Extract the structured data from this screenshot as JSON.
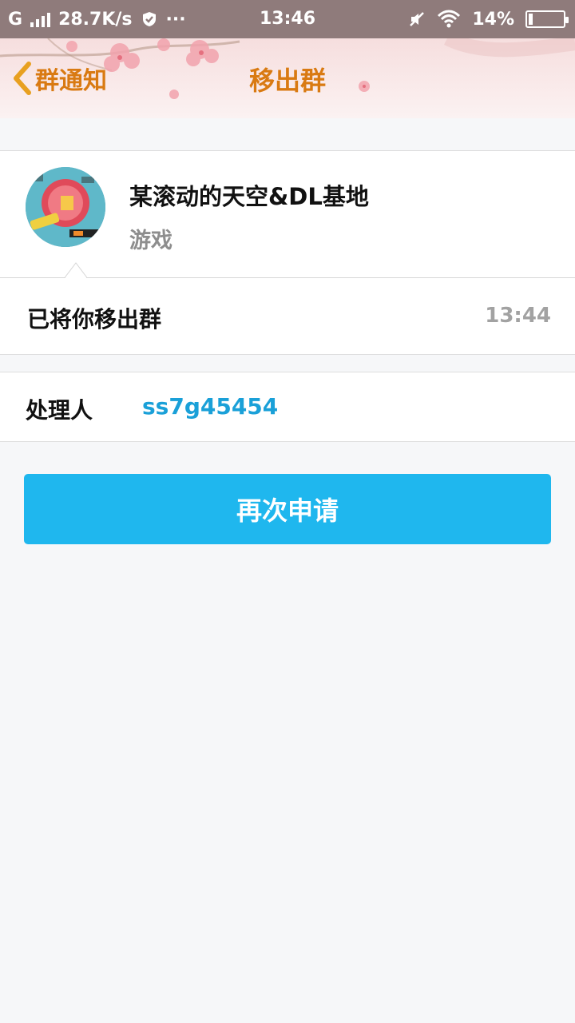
{
  "status_bar": {
    "network": "G",
    "speed": "28.7K/s",
    "more": "···",
    "time": "13:46",
    "battery": "14%"
  },
  "header": {
    "back_label": "群通知",
    "title": "移出群",
    "text_color": "#d97a12"
  },
  "group": {
    "name": "某滚动的天空&DL基地",
    "category": "游戏"
  },
  "notice": {
    "message": "已将你移出群",
    "time": "13:44"
  },
  "handler": {
    "label": "处理人",
    "value": "ss7g45454",
    "value_color": "#1aa0d8"
  },
  "actions": {
    "reapply_label": "再次申请",
    "button_color": "#1fb7ee"
  }
}
